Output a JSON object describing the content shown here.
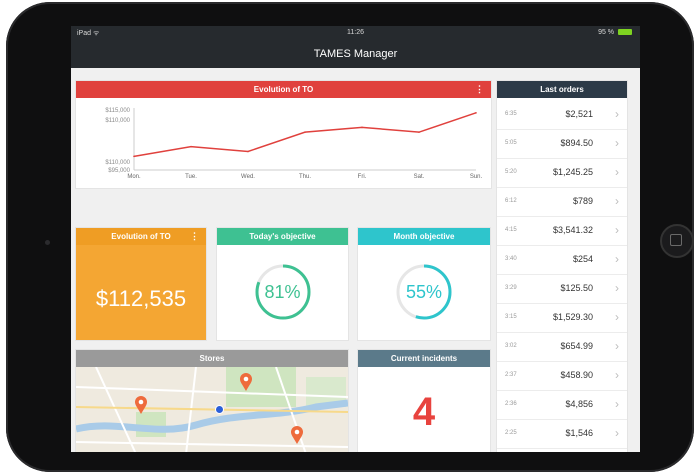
{
  "status_bar": {
    "left": "iPad ᯤ",
    "time": "11:26",
    "right": "95 %"
  },
  "app_title": "TAMES Manager",
  "evolution_chart": {
    "title": "Evolution of TO",
    "menu_icon": "kebab-menu-icon",
    "chart_data": {
      "type": "line",
      "categories": [
        "Mon.",
        "Tue.",
        "Wed.",
        "Thu.",
        "Fri.",
        "Sat.",
        "Sun."
      ],
      "series": [
        {
          "values": [
            110000,
            111000,
            110500,
            112500,
            113000,
            112500,
            114500
          ]
        }
      ],
      "y_tick_labels": [
        "$115,000",
        "$110,000",
        "$110,000",
        "$95,000"
      ],
      "ylim": [
        109000,
        115000
      ],
      "grid": false,
      "line_color": "#e0413d"
    }
  },
  "evolution_value": {
    "title": "Evolution of TO",
    "menu_icon": "kebab-menu-icon",
    "value": "$112,535"
  },
  "today_objective": {
    "title": "Today's objective",
    "label": "81%",
    "progress": 0.81,
    "color": "#3ec192"
  },
  "month_objective": {
    "title": "Month objective",
    "label": "55%",
    "progress": 0.55,
    "color": "#2ec5cc"
  },
  "stores": {
    "title": "Stores"
  },
  "incidents": {
    "title": "Current incidents",
    "count": "4"
  },
  "last_orders": {
    "title": "Last orders",
    "rows": [
      {
        "time": "6:35",
        "amount": "$2,521"
      },
      {
        "time": "5:05",
        "amount": "$894.50"
      },
      {
        "time": "5:20",
        "amount": "$1,245.25"
      },
      {
        "time": "6:12",
        "amount": "$789"
      },
      {
        "time": "4:15",
        "amount": "$3,541.32"
      },
      {
        "time": "3:40",
        "amount": "$254"
      },
      {
        "time": "3:29",
        "amount": "$125.50"
      },
      {
        "time": "3:15",
        "amount": "$1,529.30"
      },
      {
        "time": "3:02",
        "amount": "$654.99"
      },
      {
        "time": "2:37",
        "amount": "$458.90"
      },
      {
        "time": "2:36",
        "amount": "$4,856"
      },
      {
        "time": "2:25",
        "amount": "$1,546"
      }
    ]
  }
}
